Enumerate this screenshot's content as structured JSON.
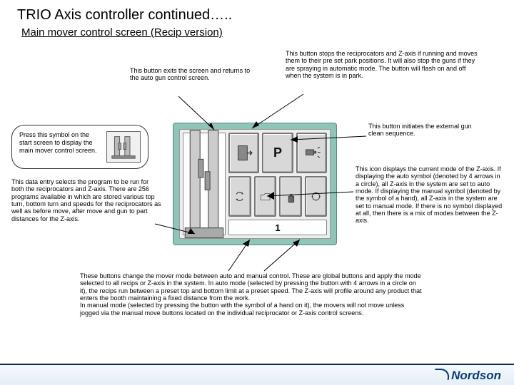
{
  "title": "TRIO Axis controller continued…..",
  "subtitle": "Main mover control screen (Recip version)",
  "ann_exit": "This button exits the screen and returns to the auto gun control screen.",
  "ann_stop": "This button stops the reciprocators and Z-axis if running and moves them to their pre set park positions. It will also stop the guns if they are spraying in automatic mode. The button will flash on and off when the system is in park.",
  "ann_press": "Press this symbol on the start screen to display the main mover control screen.",
  "ann_clean": "This button initiates the external gun clean sequence.",
  "ann_program": "This data entry selects the program to be run for both the reciprocators and Z-axis. There are 256 programs available in which are stored various top turn, bottom turn and speeds for the reciprocators as well as before move, after move and gun to part distances for the Z-axis.",
  "ann_mode_icon": "This icon displays the current mode of the Z-axis. If displaying the auto symbol (denoted by 4 arrows in a circle), all Z-axis in the system are set to auto mode. If displaying the manual symbol (denoted by the symbol of a hand), all Z-axis in the system are set to manual mode. If there is no symbol displayed at all, then there is a mix of modes between the Z-axis.",
  "ann_global": "These buttons change the mover mode between auto and manual control. These are global buttons and apply the mode selected to all recips or Z-axis in the system. In auto mode (selected by pressing the button with 4 arrows in a circle on it), the recips run between a preset top and bottom limit at a preset speed. The Z-axis will profile around any product that enters the booth maintaining a fixed distance from the work.\nIn manual mode (selected by pressing the button with the symbol of a hand on it), the movers will not move unless jogged via the manual move buttons located on the individual reciprocator or Z-axis control screens.",
  "panel": {
    "p_letter": "P",
    "program_no": "1"
  },
  "logo": "Nordson"
}
